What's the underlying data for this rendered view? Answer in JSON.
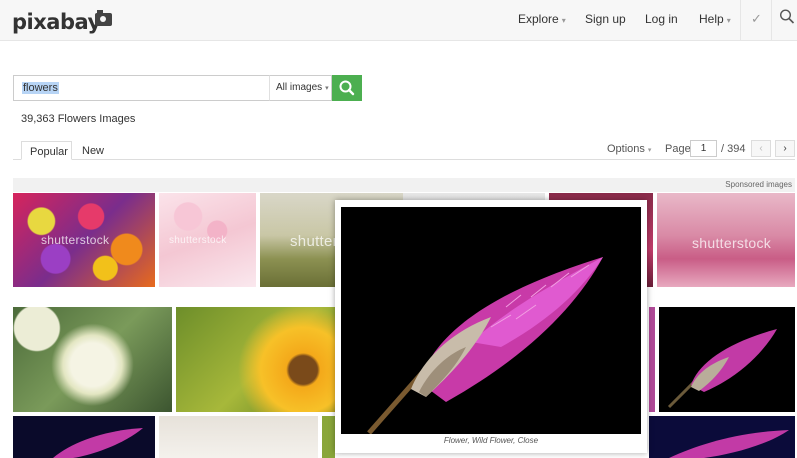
{
  "header": {
    "logo": "pixabay",
    "nav": [
      {
        "label": "Explore",
        "caret": "▾"
      },
      {
        "label": "Sign up"
      },
      {
        "label": "Log in"
      },
      {
        "label": "Help",
        "caret": "▾"
      }
    ],
    "check_icon": "✓",
    "icons": [
      "camera-icon",
      "check-icon",
      "search-icon"
    ]
  },
  "search": {
    "value": "flowers",
    "type": "All images",
    "caret": "▾"
  },
  "results": {
    "count_text": "39,363 Flowers Images"
  },
  "tabs": [
    {
      "label": "Popular",
      "active": true
    },
    {
      "label": "New",
      "active": false
    }
  ],
  "pagination": {
    "options_label": "Options",
    "caret": "▾",
    "page_label": "Page",
    "current": "1",
    "total": "/ 394",
    "prev": "‹",
    "next": "›"
  },
  "sponsored_label": "Sponsored images",
  "watermark": "shutterstock",
  "popup": {
    "caption": "Flower, Wild Flower, Close"
  },
  "colors": {
    "accent_green": "#4caf50",
    "selection": "#b7d4f5"
  }
}
